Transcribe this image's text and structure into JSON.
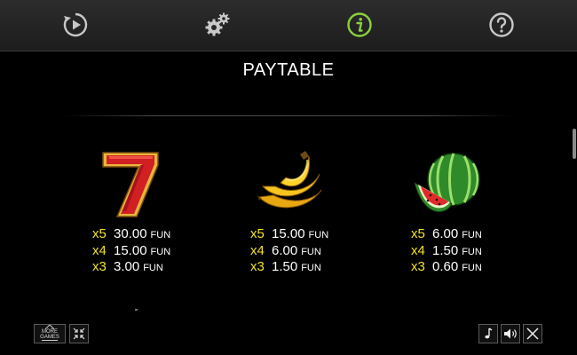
{
  "title": "PAYTABLE",
  "highlight_color": "#f2e227",
  "tabs": [
    {
      "name": "autoplay",
      "icon": "replay-icon",
      "active": false
    },
    {
      "name": "settings",
      "icon": "gears-icon",
      "active": false
    },
    {
      "name": "info",
      "icon": "info-icon",
      "active": true
    },
    {
      "name": "help",
      "icon": "question-icon",
      "active": false
    }
  ],
  "symbols": [
    {
      "icon": "seven-icon",
      "payouts": [
        {
          "mult": "x5",
          "amount": "30.00",
          "unit": "FUN"
        },
        {
          "mult": "x4",
          "amount": "15.00",
          "unit": "FUN"
        },
        {
          "mult": "x3",
          "amount": "3.00",
          "unit": "FUN"
        }
      ]
    },
    {
      "icon": "banana-icon",
      "payouts": [
        {
          "mult": "x5",
          "amount": "15.00",
          "unit": "FUN"
        },
        {
          "mult": "x4",
          "amount": "6.00",
          "unit": "FUN"
        },
        {
          "mult": "x3",
          "amount": "1.50",
          "unit": "FUN"
        }
      ]
    },
    {
      "icon": "watermelon-icon",
      "payouts": [
        {
          "mult": "x5",
          "amount": "6.00",
          "unit": "FUN"
        },
        {
          "mult": "x4",
          "amount": "1.50",
          "unit": "FUN"
        },
        {
          "mult": "x3",
          "amount": "0.60",
          "unit": "FUN"
        }
      ]
    }
  ],
  "footer": {
    "more_games_label": "MORE GAMES",
    "buttons": [
      "more-games",
      "fullscreen-toggle",
      "music-toggle",
      "sound-toggle",
      "close"
    ]
  }
}
